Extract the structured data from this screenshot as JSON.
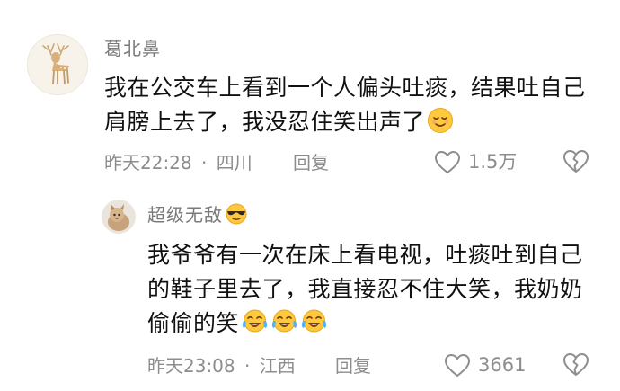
{
  "comments": [
    {
      "username": "葛北鼻",
      "avatar_icon": "deer-avatar",
      "text": "我在公交车上看到一个人偏头吐痰，结果吐自己肩膀上去了，我没忍住笑出声了",
      "emoji": "relieved-face-icon",
      "time": "昨天22:28",
      "separator": "·",
      "location": "四川",
      "reply_label": "回复",
      "like_count": "1.5万"
    },
    {
      "username": "超级无敌",
      "username_emoji": "sunglasses-face-icon",
      "avatar_icon": "cat-avatar",
      "text": "我爷爷有一次在床上看电视，吐痰吐到自己的鞋子里去了，我直接忍不住大笑，我奶奶偷偷的笑",
      "emoji": "tears-of-joy-icon",
      "emoji_count": 3,
      "time": "昨天23:08",
      "separator": "·",
      "location": "江西",
      "reply_label": "回复",
      "like_count": "3661"
    }
  ],
  "colors": {
    "text": "#111111",
    "muted": "#8d8d8d",
    "username": "#7a7a7a",
    "emoji_yellow": "#ffc83d"
  }
}
